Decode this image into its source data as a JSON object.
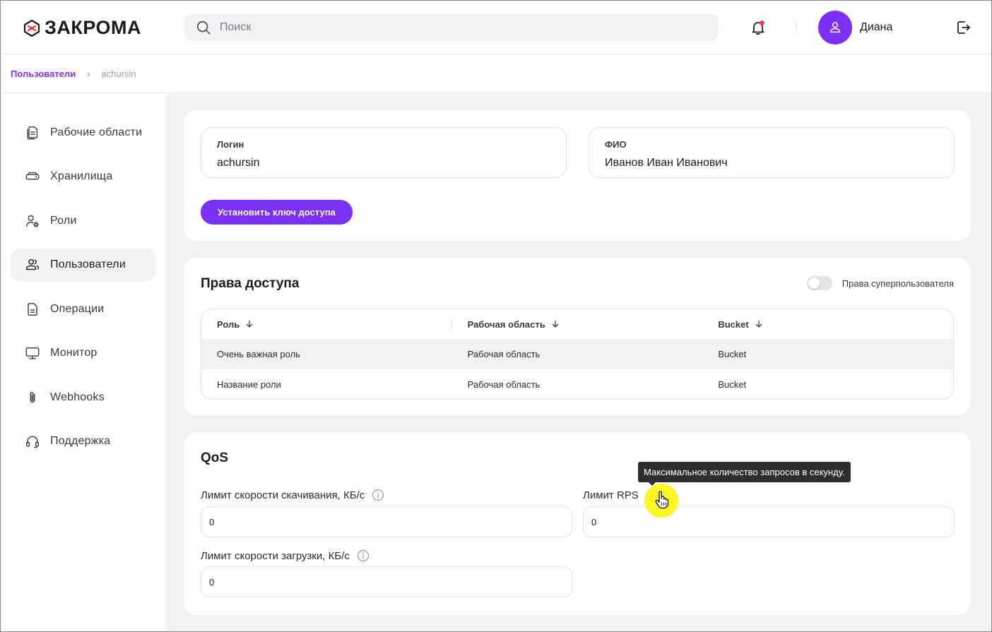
{
  "header": {
    "logo_text": "ЗАКРОМА",
    "search_placeholder": "Поиск",
    "user_name": "Диана"
  },
  "breadcrumb": {
    "root": "Пользователи",
    "separator": "›",
    "current": "achursin"
  },
  "sidebar": {
    "items": [
      {
        "label": "Рабочие области",
        "icon": "document-stack-icon"
      },
      {
        "label": "Хранилища",
        "icon": "storage-drive-icon"
      },
      {
        "label": "Роли",
        "icon": "user-gear-icon"
      },
      {
        "label": "Пользователи",
        "icon": "users-icon",
        "active": true
      },
      {
        "label": "Операции",
        "icon": "document-icon"
      },
      {
        "label": "Монитор",
        "icon": "monitor-icon"
      },
      {
        "label": "Webhooks",
        "icon": "paperclip-icon"
      },
      {
        "label": "Поддержка",
        "icon": "headset-icon"
      }
    ]
  },
  "user_card": {
    "login_label": "Логин",
    "login_value": "achursin",
    "fio_label": "ФИО",
    "fio_value": "Иванов Иван Иванович",
    "set_key_button": "Установить ключ доступа"
  },
  "access": {
    "title": "Права доступа",
    "superuser_label": "Права суперпользователя",
    "superuser_enabled": false,
    "columns": [
      "Роль",
      "Рабочая область",
      "Bucket"
    ],
    "rows": [
      [
        "Очень важная роль",
        "Рабочая область",
        "Bucket"
      ],
      [
        "Название роли",
        "Рабочая область",
        "Bucket"
      ]
    ]
  },
  "qos": {
    "title": "QoS",
    "download_label": "Лимит скорости скачивания, КБ/с",
    "download_value": "0",
    "rps_label": "Лимит RPS",
    "rps_value": "0",
    "upload_label": "Лимит скорости загрузки, КБ/с",
    "upload_value": "0",
    "tooltip": "Максимальное количество запросов в секунду."
  },
  "colors": {
    "accent": "#7b2ff7",
    "logo_red": "#e63946",
    "notification_dot": "#ff2a55",
    "background": "#f1f2f4"
  }
}
